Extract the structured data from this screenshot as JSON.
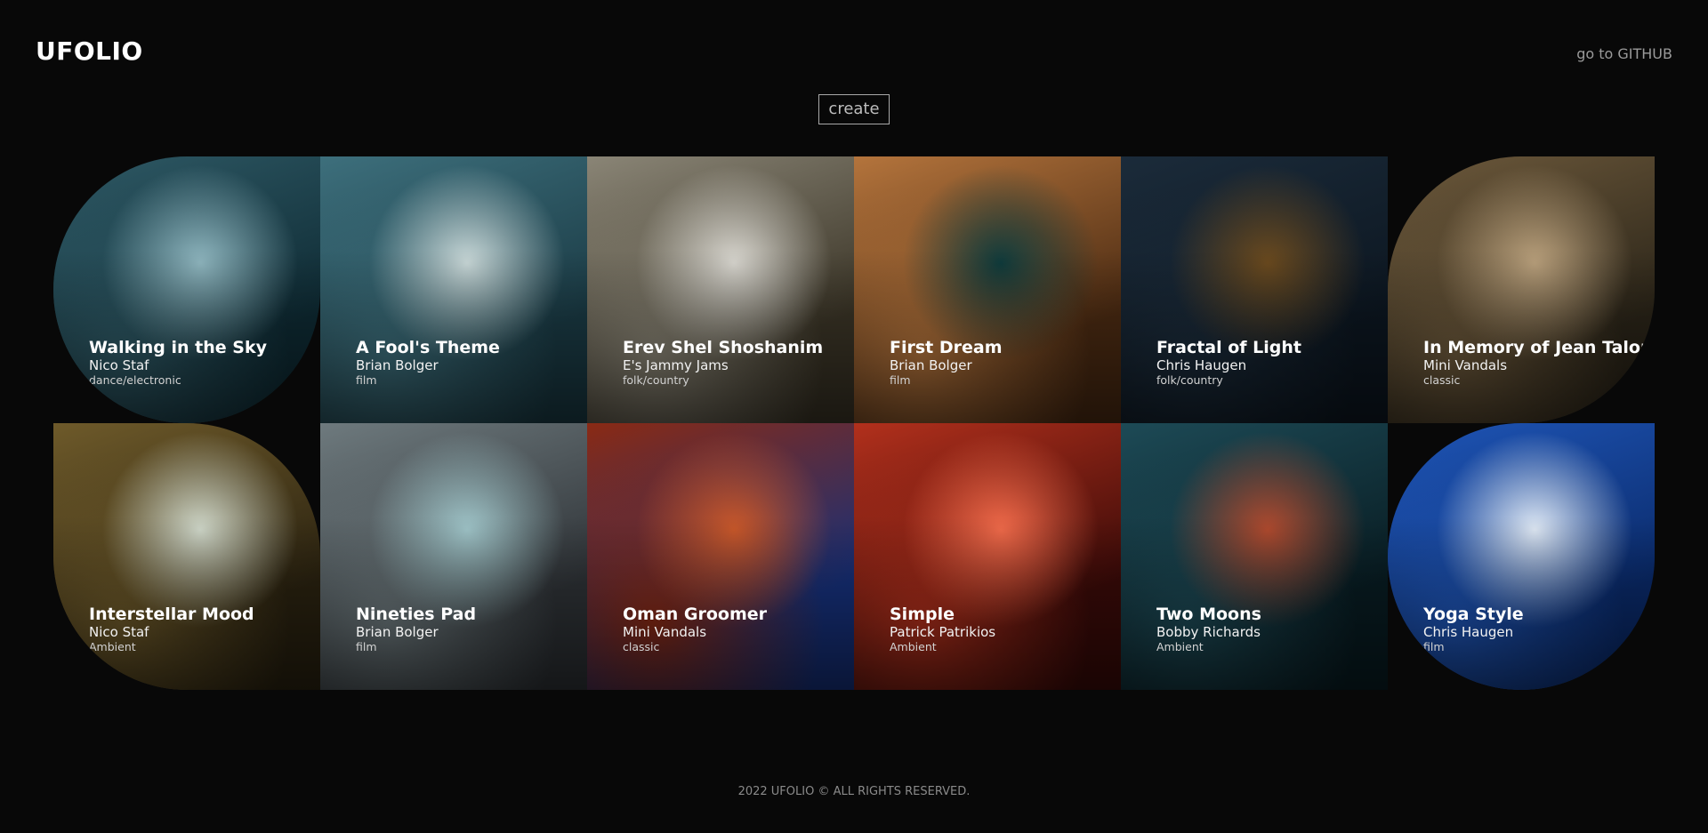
{
  "header": {
    "logo": "UFOLIO",
    "github_link": "go to GITHUB"
  },
  "create_button": "create",
  "cards": [
    {
      "title": "Walking in the Sky",
      "artist": "Nico Staf",
      "genre": "dance/electronic",
      "palette": [
        "#0e2a33",
        "#2f5a66",
        "#8fb6bf"
      ]
    },
    {
      "title": "A Fool's Theme",
      "artist": "Brian Bolger",
      "genre": "film",
      "palette": [
        "#1a3a44",
        "#3d6f7c",
        "#c9d8d8"
      ]
    },
    {
      "title": "Erev Shel Shoshanim",
      "artist": "E's Jammy Jams",
      "genre": "folk/country",
      "palette": [
        "#3a3426",
        "#8a8576",
        "#d8d6cf"
      ]
    },
    {
      "title": "First Dream",
      "artist": "Brian Bolger",
      "genre": "film",
      "palette": [
        "#4a2a12",
        "#b4743c",
        "#0f3b3c"
      ]
    },
    {
      "title": "Fractal of Light",
      "artist": "Chris Haugen",
      "genre": "folk/country",
      "palette": [
        "#0c1620",
        "#1b2b3a",
        "#6b4a1e"
      ]
    },
    {
      "title": "In Memory of Jean Talon",
      "artist": "Mini Vandals",
      "genre": "classic",
      "palette": [
        "#2a2418",
        "#6e5a3c",
        "#b9a07c"
      ]
    },
    {
      "title": "Interstellar Mood",
      "artist": "Nico Staf",
      "genre": "Ambient",
      "palette": [
        "#2a2210",
        "#6e5a2a",
        "#cfd7c9"
      ]
    },
    {
      "title": "Nineties Pad",
      "artist": "Brian Bolger",
      "genre": "film",
      "palette": [
        "#2e3236",
        "#6e7a7e",
        "#9fc4c8"
      ]
    },
    {
      "title": "Oman Groomer",
      "artist": "Mini Vandals",
      "genre": "classic",
      "palette": [
        "#16307a",
        "#8a2a14",
        "#c9582a"
      ]
    },
    {
      "title": "Simple",
      "artist": "Patrick Patrikios",
      "genre": "Ambient",
      "palette": [
        "#3a0a08",
        "#b2301c",
        "#f06a4a"
      ]
    },
    {
      "title": "Two Moons",
      "artist": "Bobby Richards",
      "genre": "Ambient",
      "palette": [
        "#081c22",
        "#1d4a56",
        "#b04a2e"
      ]
    },
    {
      "title": "Yoga Style",
      "artist": "Chris Haugen",
      "genre": "film",
      "palette": [
        "#0a2a6a",
        "#1f56b8",
        "#dfe9f5"
      ]
    }
  ],
  "footer": {
    "text": "2022 UFOLIO © ALL RIGHTS RESERVED."
  }
}
